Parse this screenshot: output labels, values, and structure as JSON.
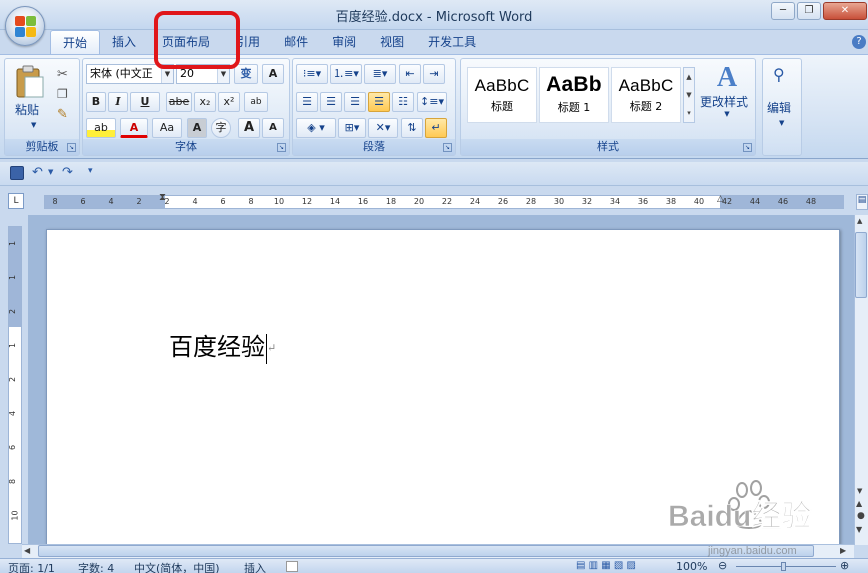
{
  "window": {
    "title": "百度经验.docx - Microsoft Word",
    "minimize_glyph": "─",
    "restore_glyph": "❐",
    "close_glyph": "✕"
  },
  "tabs": [
    "开始",
    "插入",
    "页面布局",
    "引用",
    "邮件",
    "审阅",
    "视图",
    "开发工具"
  ],
  "active_tab": "开始",
  "highlighted_tab": "页面布局",
  "help_glyph": "?",
  "ribbon": {
    "clipboard": {
      "label": "剪贴板",
      "paste_label": "粘贴"
    },
    "font": {
      "label": "字体",
      "font_name": "宋体 (中文正",
      "font_size": "20",
      "bold": "B",
      "italic": "I",
      "underline": "U",
      "strikethrough": "abe",
      "subscript": "x₂",
      "superscript": "x²",
      "change_case": "Aa",
      "font_color": "A",
      "grow_font": "A",
      "shrink_font": "A",
      "char_border": "A",
      "enclose": "字",
      "phonetic": "变",
      "abc_glyph": "ab",
      "highlight_glyph": "ab"
    },
    "paragraph": {
      "label": "段落"
    },
    "styles": {
      "label": "样式",
      "tiles": [
        {
          "sample": "AaBbC",
          "name": "标题"
        },
        {
          "sample": "AaBb",
          "name": "标题 1"
        },
        {
          "sample": "AaBbC",
          "name": "标题 2"
        }
      ],
      "change_styles_label": "更改样式"
    },
    "editing": {
      "label": "编辑"
    }
  },
  "ruler": {
    "h_numbers": [
      "8",
      "6",
      "4",
      "2",
      "2",
      "4",
      "6",
      "8",
      "10",
      "12",
      "14",
      "16",
      "18",
      "20",
      "22",
      "24",
      "26",
      "28",
      "30",
      "32",
      "34",
      "36",
      "38",
      "40",
      "42",
      "44",
      "46",
      "48"
    ],
    "v_numbers": [
      "1",
      "1",
      "2",
      "1",
      "2",
      "4",
      "6",
      "8",
      "10"
    ]
  },
  "document": {
    "text": "百度经验"
  },
  "status": {
    "page": "页面: 1/1",
    "words": "字数: 4",
    "language": "中文(简体，中国)",
    "insert_mode": "插入",
    "zoom": "100%"
  },
  "watermark": {
    "brand": "Baidu经验",
    "url": "jingyan.baidu.com"
  },
  "colors": {
    "highlight_box": "#e0161a",
    "office_logo": [
      "#e44b1e",
      "#7cbd3c",
      "#2f84d3",
      "#f5b914"
    ]
  }
}
